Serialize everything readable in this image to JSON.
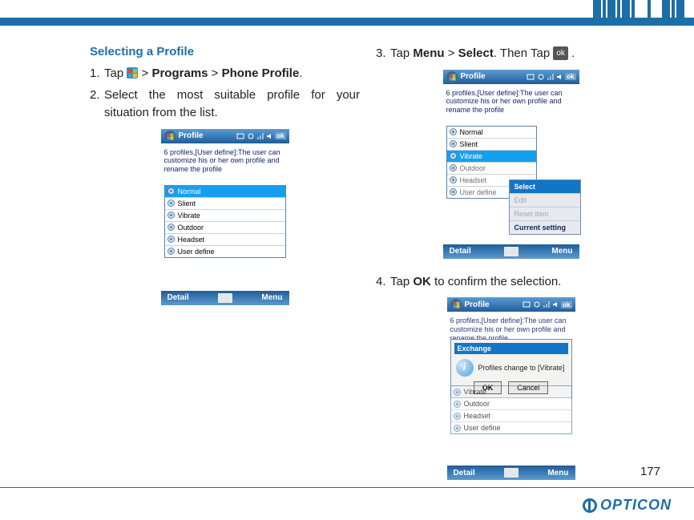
{
  "page_number": "177",
  "brand": "OPTICON",
  "heading": "Selecting a Profile",
  "step1": {
    "num": "1.",
    "pre": "Tap ",
    "mid1": " > ",
    "bold1": "Programs",
    "mid2": " > ",
    "bold2": "Phone Profile",
    "post": "."
  },
  "step2": {
    "num": "2.",
    "text": "Select the most suitable profile for your situation from the list."
  },
  "step3": {
    "num": "3.",
    "pre": "Tap ",
    "bold1": "Menu",
    "mid1": " > ",
    "bold2": "Select",
    "mid2": ". Then Tap ",
    "post": " ."
  },
  "step4": {
    "num": "4.",
    "pre": "Tap ",
    "bold1": "OK",
    "post": " to confirm the selection."
  },
  "ok_chip": "ok",
  "wm": {
    "title": "Profile",
    "ok": "ok",
    "desc": "6 profiles,[User define]:The user can customize his or her own profile and rename the profile",
    "items": [
      "Normal",
      "Slient",
      "Vibrate",
      "Outdoor",
      "Headset",
      "User define"
    ],
    "detail": "Detail",
    "menu": "Menu"
  },
  "menu_items": {
    "select": "Select",
    "edit": "Edit",
    "reset": "Reset item",
    "current": "Current setting"
  },
  "dialog": {
    "title": "Exchange",
    "msg": "Profiles change to [Vibrate]",
    "ok": "OK",
    "cancel": "Cancel"
  }
}
